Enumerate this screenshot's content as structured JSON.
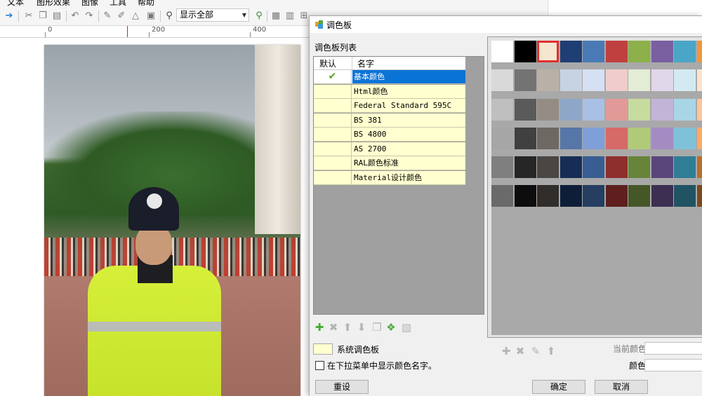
{
  "menu": [
    "文本",
    "图形效果",
    "图像",
    "工具",
    "帮助"
  ],
  "toolbar": {
    "zoom_value": "显示全部"
  },
  "ruler": {
    "labels": [
      "0",
      "200",
      "400"
    ]
  },
  "dialog": {
    "title": "调色板",
    "list_title": "调色板列表",
    "columns": {
      "default": "默认",
      "name": "名字"
    },
    "palettes": [
      {
        "name": "基本颜色",
        "is_default": true,
        "selected": true
      },
      {
        "name": "Html颜色",
        "is_default": false
      },
      {
        "name": "Federal Standard 595C",
        "is_default": false
      },
      {
        "name": "BS 381",
        "is_default": false
      },
      {
        "name": "BS 4800",
        "is_default": false
      },
      {
        "name": "AS 2700",
        "is_default": false
      },
      {
        "name": "RAL颜色标准",
        "is_default": false
      },
      {
        "name": "Material设计颜色",
        "is_default": false
      }
    ],
    "default_check": "✔",
    "system_palette_label": "系统调色板",
    "show_names_label": "在下拉菜单中显示颜色名字。",
    "show_names_checked": false,
    "reset_label": "重设",
    "ok_label": "确定",
    "cancel_label": "取消",
    "current_color_label": "当前颜色",
    "color_name_label": "颜色名",
    "swatch_rows": [
      [
        "#ffffff",
        "#000000",
        "#f5e6cf",
        "#1f3e73",
        "#4a7ab5",
        "#c0403f",
        "#8cb04a",
        "#7a5fa1",
        "#4aa6c6",
        "#f0963c"
      ],
      [
        "#d9d9d9",
        "#737373",
        "#b9b0a6",
        "#c6d3e3",
        "#d5e0f3",
        "#f0cccc",
        "#e3edd6",
        "#e0d8ea",
        "#d4eaf2",
        "#fde3cc"
      ],
      [
        "#bfbfbf",
        "#5a5a5a",
        "#958d85",
        "#8ea7c9",
        "#a9c0e6",
        "#e29a98",
        "#c8db9e",
        "#c2b4d6",
        "#a9d6e6",
        "#fcc699"
      ],
      [
        "#a6a6a6",
        "#404040",
        "#6e6862",
        "#5776a8",
        "#7f9fd8",
        "#d56a67",
        "#b0cb78",
        "#a48cc2",
        "#7fc2d8",
        "#f9aa66"
      ],
      [
        "#7f7f7f",
        "#262626",
        "#4a4643",
        "#172d55",
        "#385d92",
        "#8e2e2d",
        "#68833a",
        "#5b467b",
        "#307d96",
        "#b86f2a"
      ],
      [
        "#6a6a6a",
        "#0d0d0d",
        "#302d2b",
        "#0f1e38",
        "#253e61",
        "#5e1f1e",
        "#455727",
        "#3c2f52",
        "#205364",
        "#7a4a1c"
      ]
    ],
    "selected_swatch": "#f5e6cf"
  }
}
